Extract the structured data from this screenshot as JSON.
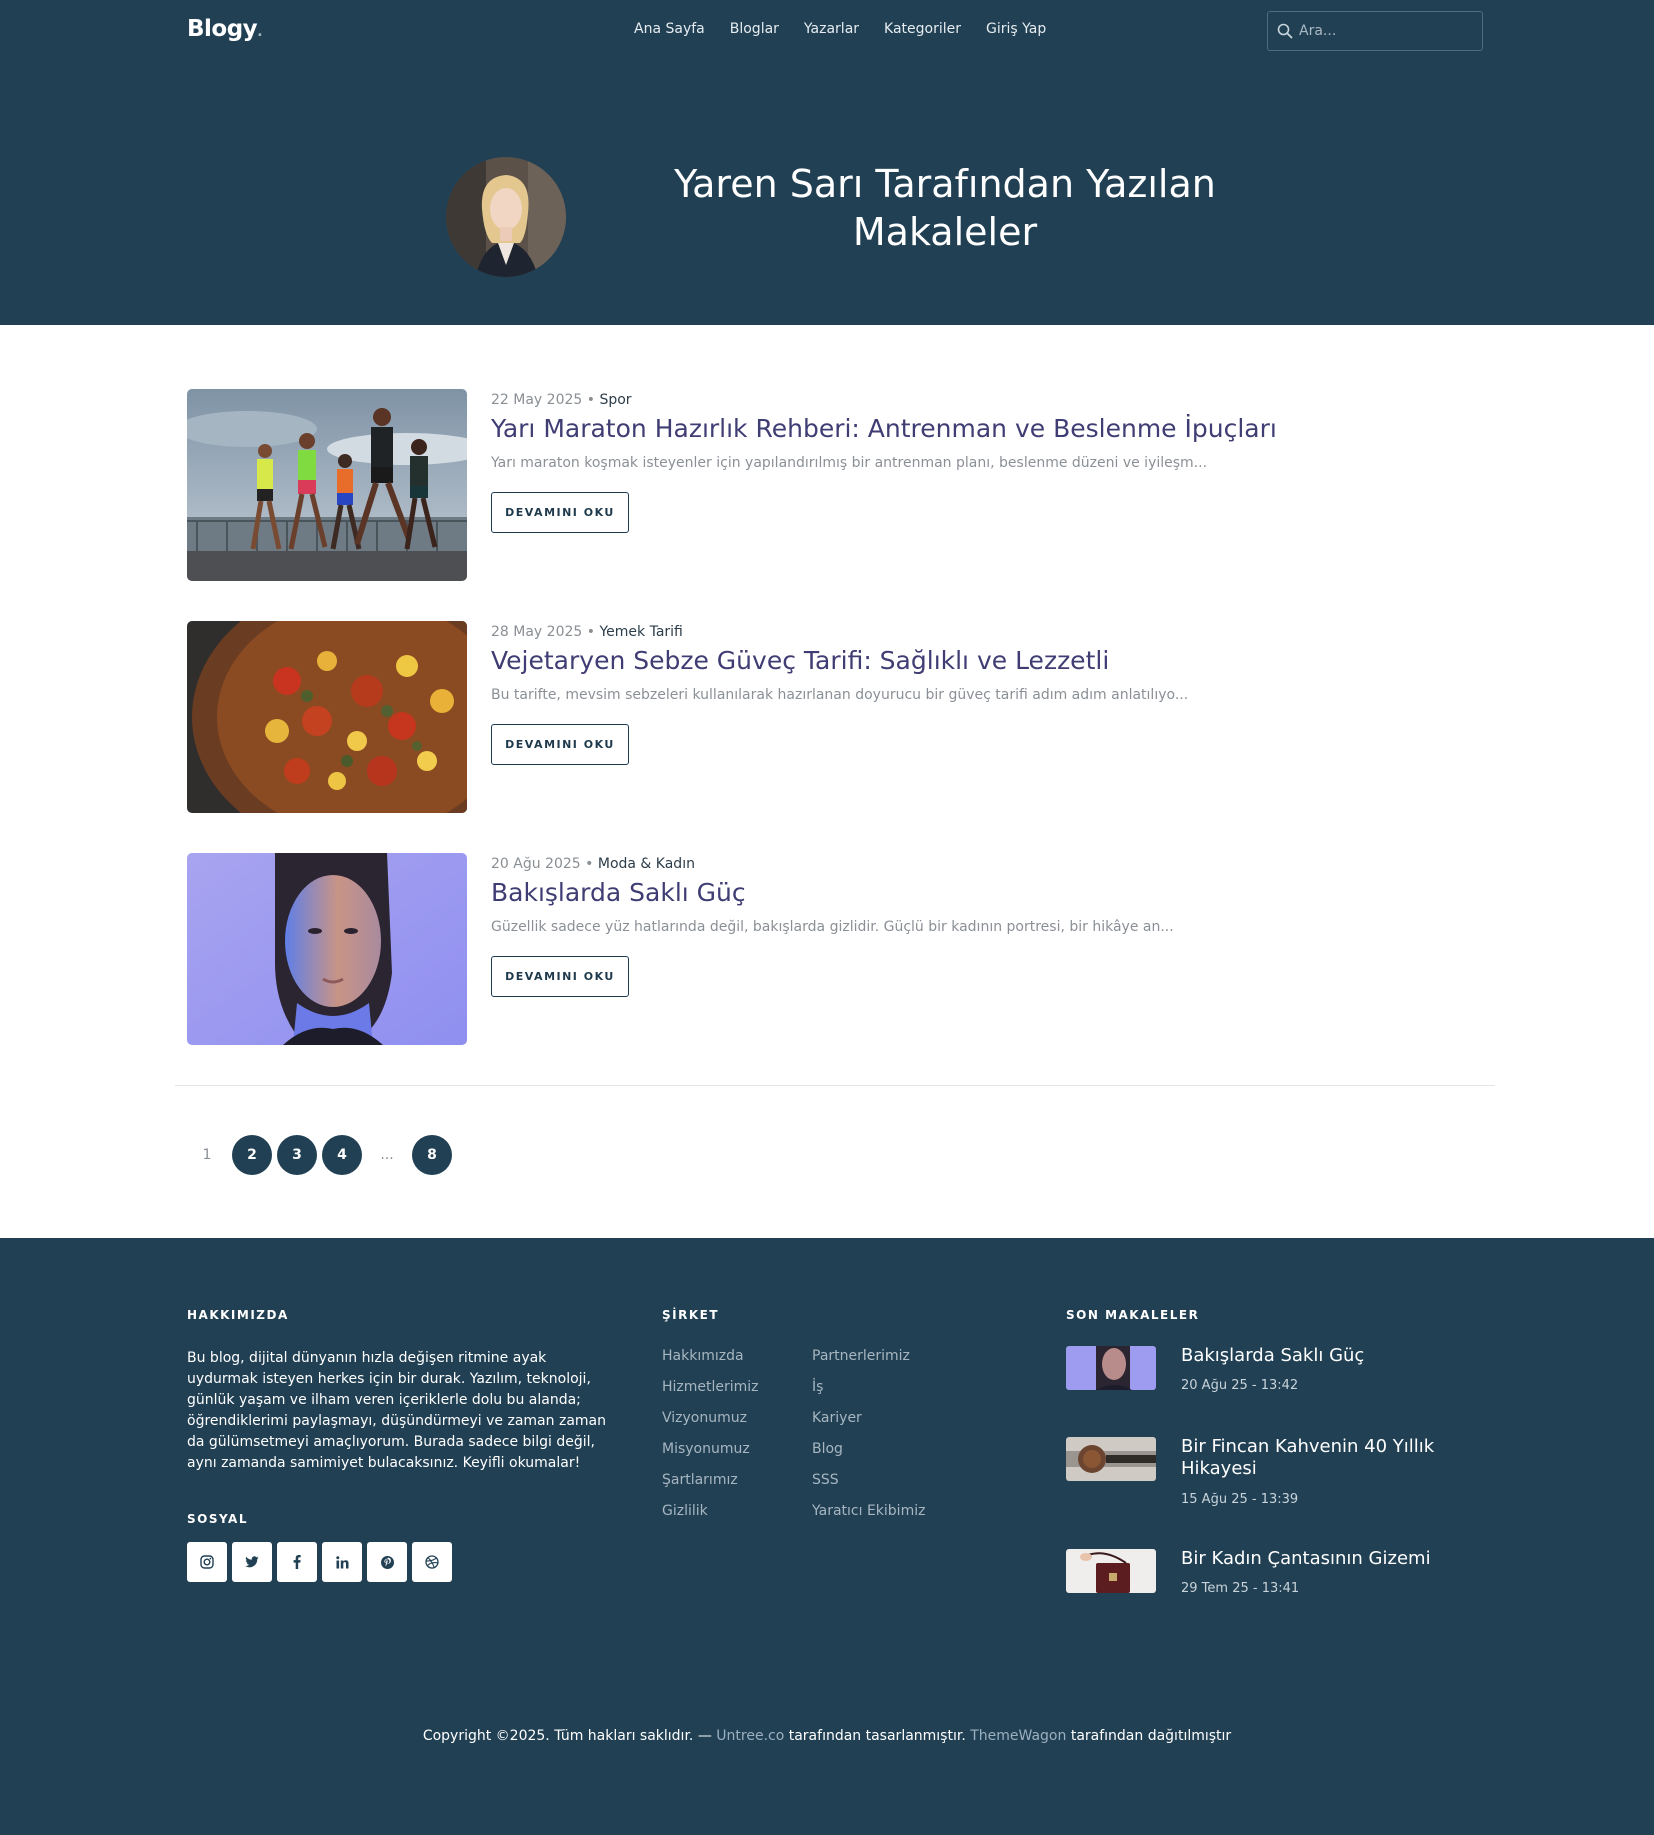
{
  "brand": {
    "name": "Blogy",
    "dot": "."
  },
  "nav": [
    {
      "label": "Ana Sayfa"
    },
    {
      "label": "Bloglar"
    },
    {
      "label": "Yazarlar"
    },
    {
      "label": "Kategoriler"
    },
    {
      "label": "Giriş Yap"
    }
  ],
  "search": {
    "placeholder": "Ara...",
    "icon": "search-icon"
  },
  "hero": {
    "title": "Yaren Sarı Tarafından Yazılan Makaleler",
    "avatar_icon": "author-avatar"
  },
  "articles": [
    {
      "date": "22 May 2025",
      "separator": "•",
      "category": "Spor",
      "title": "Yarı Maraton Hazırlık Rehberi: Antrenman ve Beslenme İpuçları",
      "excerpt": "Yarı maraton koşmak isteyenler için yapılandırılmış bir antrenman planı, beslenme düzeni ve iyileşm...",
      "button": "DEVAMINI OKU"
    },
    {
      "date": "28 May 2025",
      "separator": "•",
      "category": "Yemek Tarifi",
      "title": "Vejetaryen Sebze Güveç Tarifi: Sağlıklı ve Lezzetli",
      "excerpt": "Bu tarifte, mevsim sebzeleri kullanılarak hazırlanan doyurucu bir güveç tarifi adım adım anlatılıyo...",
      "button": "DEVAMINI OKU"
    },
    {
      "date": "20 Ağu 2025",
      "separator": "•",
      "category": "Moda & Kadın",
      "title": "Bakışlarda Saklı Güç",
      "excerpt": "Güzellik sadece yüz hatlarında değil, bakışlarda gizlidir. Güçlü bir kadının portresi, bir hikâye an...",
      "button": "DEVAMINI OKU"
    }
  ],
  "pagination": {
    "current": "1",
    "pages": [
      "2",
      "3",
      "4"
    ],
    "ellipsis": "...",
    "last": "8"
  },
  "footer": {
    "about_heading": "HAKKIMIZDA",
    "about_text": "Bu blog, dijital dünyanın hızla değişen ritmine ayak uydurmak isteyen herkes için bir durak. Yazılım, teknoloji, günlük yaşam ve ilham veren içeriklerle dolu bu alanda; öğrendiklerimi paylaşmayı, düşündürmeyi ve zaman zaman da gülümsetmeyi amaçlıyorum. Burada sadece bilgi değil, aynı zamanda samimiyet bulacaksınız. Keyifli okumalar!",
    "social_heading": "SOSYAL",
    "socials": [
      "instagram-icon",
      "twitter-icon",
      "facebook-icon",
      "linkedin-icon",
      "pinterest-icon",
      "dribbble-icon"
    ],
    "company_heading": "ŞİRKET",
    "company_col1": [
      "Hakkımızda",
      "Hizmetlerimiz",
      "Vizyonumuz",
      "Misyonumuz",
      "Şartlarımız",
      "Gizlilik"
    ],
    "company_col2": [
      "Partnerlerimiz",
      "İş",
      "Kariyer",
      "Blog",
      "SSS",
      "Yaratıcı Ekibimiz"
    ],
    "recent_heading": "SON MAKALELER",
    "recent": [
      {
        "title": "Bakışlarda Saklı Güç",
        "date": "20 Ağu 25 - 13:42"
      },
      {
        "title": "Bir Fincan Kahvenin 40 Yıllık Hikayesi",
        "date": "15 Ağu 25 - 13:39"
      },
      {
        "title": "Bir Kadın Çantasının Gizemi",
        "date": "29 Tem 25 - 13:41"
      }
    ],
    "copyright": {
      "prefix": "Copyright ©2025. Tüm hakları saklıdır. — ",
      "link1": "Untree.co",
      "middle": " tarafından tasarlanmıştır. ",
      "link2": "ThemeWagon",
      "suffix": " tarafından dağıtılmıştır"
    }
  },
  "colors": {
    "primary_dark": "#214054",
    "title_purple": "#3f3d73",
    "muted_text": "#8b9096"
  }
}
